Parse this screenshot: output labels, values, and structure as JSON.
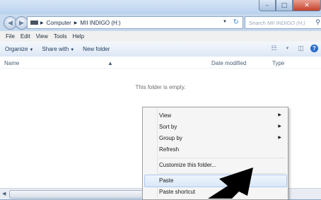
{
  "address": {
    "breadcrumbs": [
      "Computer",
      "MII INDIGO (H:)"
    ],
    "search_placeholder": "Search MII INDIGO (H:)"
  },
  "menu": [
    "File",
    "Edit",
    "View",
    "Tools",
    "Help"
  ],
  "toolbar": {
    "organize": "Organize",
    "share_with": "Share with",
    "new_folder": "New folder"
  },
  "columns": [
    "Name",
    "Date modified",
    "Type"
  ],
  "empty_message": "This folder is empty.",
  "context_menu": {
    "view": "View",
    "sort_by": "Sort by",
    "group_by": "Group by",
    "refresh": "Refresh",
    "customize": "Customize this folder...",
    "paste": "Paste",
    "paste_shortcut": "Paste shortcut",
    "highlighted": "Paste"
  },
  "icons": {
    "back": "back-arrow-icon",
    "forward": "forward-arrow-icon",
    "drive": "drive-icon",
    "refresh": "refresh-icon",
    "search": "search-icon",
    "views": "view-options-icon",
    "preview": "preview-pane-icon",
    "help": "help-icon",
    "cursor": "mouse-pointer-icon"
  },
  "colors": {
    "title_bar": "#c8daee",
    "close_button": "#c4412c",
    "toolbar_bg": "#dce7f5",
    "menu_highlight": "#d8e8f8"
  }
}
